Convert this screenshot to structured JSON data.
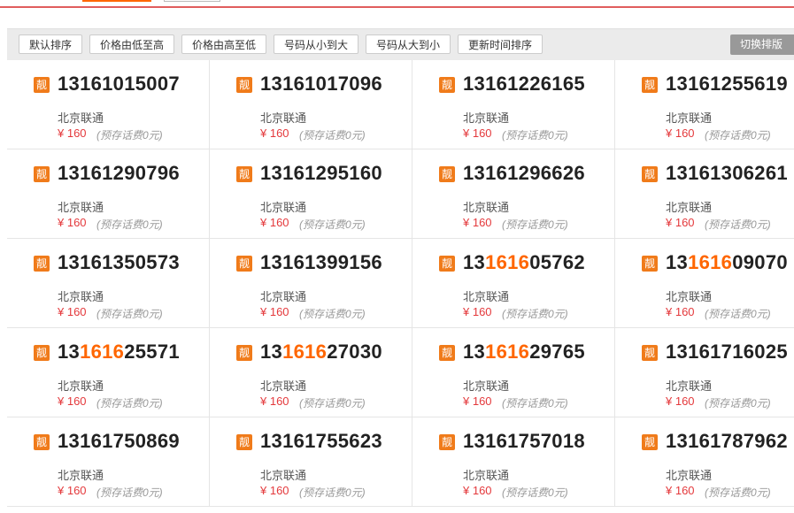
{
  "sort_bar": {
    "buttons": [
      "默认排序",
      "价格由低至高",
      "价格由高至低",
      "号码从小到大",
      "号码从大到小",
      "更新时间排序"
    ],
    "active_index": 1,
    "switch_label": "切换排版"
  },
  "badge_label": "靓",
  "numbers": [
    {
      "number": "13161015007",
      "carrier": "北京联通",
      "price": "¥ 160",
      "note": "(预存话费0元)"
    },
    {
      "number": "13161017096",
      "carrier": "北京联通",
      "price": "¥ 160",
      "note": "(预存话费0元)"
    },
    {
      "number": "13161226165",
      "carrier": "北京联通",
      "price": "¥ 160",
      "note": "(预存话费0元)"
    },
    {
      "number": "13161255619",
      "carrier": "北京联通",
      "price": "¥ 160",
      "note": "(预存话费0元)"
    },
    {
      "number": "13161290796",
      "carrier": "北京联通",
      "price": "¥ 160",
      "note": "(预存话费0元)"
    },
    {
      "number": "13161295160",
      "carrier": "北京联通",
      "price": "¥ 160",
      "note": "(预存话费0元)"
    },
    {
      "number": "13161296626",
      "carrier": "北京联通",
      "price": "¥ 160",
      "note": "(预存话费0元)"
    },
    {
      "number": "13161306261",
      "carrier": "北京联通",
      "price": "¥ 160",
      "note": "(预存话费0元)"
    },
    {
      "number": "13161350573",
      "carrier": "北京联通",
      "price": "¥ 160",
      "note": "(预存话费0元)"
    },
    {
      "number": "13161399156",
      "carrier": "北京联通",
      "price": "¥ 160",
      "note": "(预存话费0元)"
    },
    {
      "number": "13161605762",
      "highlight": "1616",
      "carrier": "北京联通",
      "price": "¥ 160",
      "note": "(预存话费0元)"
    },
    {
      "number": "13161609070",
      "highlight": "1616",
      "carrier": "北京联通",
      "price": "¥ 160",
      "note": "(预存话费0元)"
    },
    {
      "number": "13161625571",
      "highlight": "1616",
      "carrier": "北京联通",
      "price": "¥ 160",
      "note": "(预存话费0元)"
    },
    {
      "number": "13161627030",
      "highlight": "1616",
      "carrier": "北京联通",
      "price": "¥ 160",
      "note": "(预存话费0元)"
    },
    {
      "number": "13161629765",
      "highlight": "1616",
      "carrier": "北京联通",
      "price": "¥ 160",
      "note": "(预存话费0元)"
    },
    {
      "number": "13161716025",
      "carrier": "北京联通",
      "price": "¥ 160",
      "note": "(预存话费0元)"
    },
    {
      "number": "13161750869",
      "carrier": "北京联通",
      "price": "¥ 160",
      "note": "(预存话费0元)"
    },
    {
      "number": "13161755623",
      "carrier": "北京联通",
      "price": "¥ 160",
      "note": "(预存话费0元)"
    },
    {
      "number": "13161757018",
      "carrier": "北京联通",
      "price": "¥ 160",
      "note": "(预存话费0元)"
    },
    {
      "number": "13161787962",
      "carrier": "北京联通",
      "price": "¥ 160",
      "note": "(预存话费0元)"
    }
  ],
  "colors": {
    "accent": "#ff6600",
    "price": "#e4393c",
    "badge": "#f07b1a"
  }
}
